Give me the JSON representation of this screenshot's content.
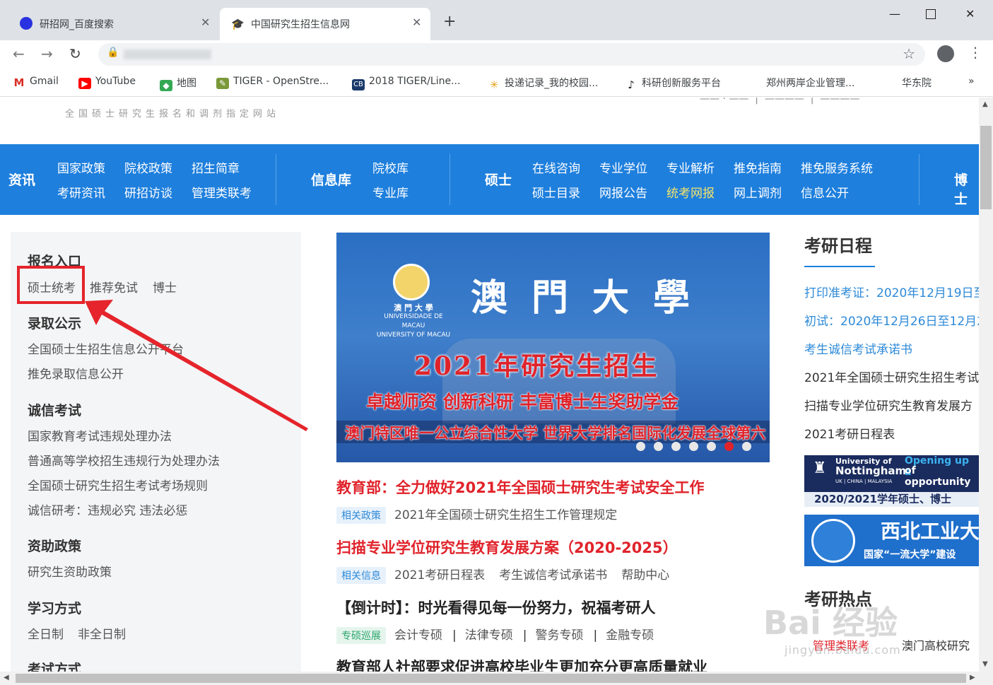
{
  "browser": {
    "tabs": [
      {
        "title": "研招网_百度搜索",
        "icon": "baidu-icon"
      },
      {
        "title": "中国研究生招生信息网",
        "icon": "graduation-cap-icon"
      }
    ],
    "bookmarks": [
      {
        "label": "Gmail",
        "icon": "gmail-icon"
      },
      {
        "label": "YouTube",
        "icon": "youtube-icon"
      },
      {
        "label": "地图",
        "icon": "maps-icon"
      },
      {
        "label": "TIGER - OpenStre...",
        "icon": "tiger-icon"
      },
      {
        "label": "2018 TIGER/Line...",
        "icon": "cb-icon"
      },
      {
        "label": "投递记录_我的校园...",
        "icon": "flower-icon"
      },
      {
        "label": "科研创新服务平台",
        "icon": "note-icon"
      },
      {
        "label": "郑州两岸企业管理...",
        "icon": ""
      },
      {
        "label": "华东院",
        "icon": ""
      },
      {
        "label": "»",
        "icon": ""
      }
    ]
  },
  "site": {
    "tagline": "全国硕士研究生报名和调剂指定网站",
    "nav": {
      "zixun": "资讯",
      "zixun_links": [
        "国家政策",
        "院校政策",
        "招生简章",
        "考研资讯",
        "研招访谈",
        "管理类联考"
      ],
      "xinxiku": "信息库",
      "xinxiku_links": [
        "院校库",
        "专业库"
      ],
      "shuoshi": "硕士",
      "shuoshi_links": [
        "在线咨询",
        "专业学位",
        "专业解析",
        "推免指南",
        "推免服务系统",
        "硕士目录",
        "网报公告",
        "统考网报",
        "网上调剂",
        "信息公开"
      ],
      "boshi": "博士"
    },
    "left": {
      "sections": [
        {
          "heading": "报名入口",
          "items": [
            "硕士统考",
            "推荐免试",
            "博士"
          ]
        },
        {
          "heading": "录取公示",
          "items": [
            "全国硕士生招生信息公开平台",
            "推免录取信息公开"
          ]
        },
        {
          "heading": "诚信考试",
          "items": [
            "国家教育考试违规处理办法",
            "普通高等学校招生违规行为处理办法",
            "全国硕士研究生招生考试考场规则",
            "诚信研考：违规必究 违法必惩"
          ]
        },
        {
          "heading": "资助政策",
          "items": [
            "研究生资助政策"
          ]
        },
        {
          "heading": "学习方式",
          "items": [
            "全日制",
            "非全日制"
          ]
        },
        {
          "heading": "考试方式",
          "items": []
        }
      ]
    },
    "banner": {
      "uni_name_cn": "澳門大學",
      "uni_small": "澳 門 大 學",
      "uni_pt": "UNIVERSIDADE DE MACAU",
      "uni_en": "UNIVERSITY OF MACAU",
      "year_line": "2021年研究生招生",
      "slogan1": "卓越师资 创新科研 丰富博士生奖助学金",
      "slogan2": "澳门特区唯一公立综合性大学 世界大学排名国际化发展全球第六",
      "slides": 7,
      "active_slide": 6
    },
    "news": [
      {
        "headline": "教育部：全力做好2021年全国硕士研究生考试安全工作",
        "tag": "相关政策",
        "items": [
          "2021年全国硕士研究生招生工作管理规定"
        ]
      },
      {
        "headline": "扫描专业学位研究生教育发展方案（2020-2025）",
        "tag": "相关信息",
        "items": [
          "2021考研日程表",
          "考生诚信考试承诺书",
          "帮助中心"
        ]
      },
      {
        "headline": "【倒计时】：时光看得见每一份努力，祝福考研人",
        "tag": "专硕巡展",
        "items": [
          "会计专硕",
          "法律专硕",
          "警务专硕",
          "金融专硕"
        ]
      },
      {
        "headline": "教育部人社部要求促进高校毕业生更加充分更高质量就业"
      }
    ],
    "right": {
      "title": "考研日程",
      "items": [
        "打印准考证：2020年12月19日至",
        "初试：2020年12月26日至12月2",
        "考生诚信考试承诺书",
        "2021年全国硕士研究生招生考试",
        "扫描专业学位研究生教育发展方",
        "2021考研日程表"
      ],
      "ad1_line1": "University of",
      "ad1_line2": "Nottingham",
      "ad1_line3": "UK | CHINA | MALAYSIA",
      "ad1_slogan": "Opening up a",
      "ad1_slogan2": "of opportunity",
      "ad1_bottom": "2020/2021学年硕士、博士",
      "ad2_title": "西北工业大",
      "ad2_sub": "国家“一流大学”建设",
      "hot_title": "考研热点",
      "hot_tabs": [
        "管理类联考",
        "澳门高校研究"
      ]
    },
    "watermark": "Bai 经验",
    "watermark_url": "jingyan.baidu.com"
  },
  "colors": {
    "nav_blue": "#1e7fdd",
    "headline_red": "#e0232b",
    "link_blue": "#2e8ad8",
    "highlight_yellow": "#f5e36a",
    "annotation_red": "#e5242b"
  }
}
